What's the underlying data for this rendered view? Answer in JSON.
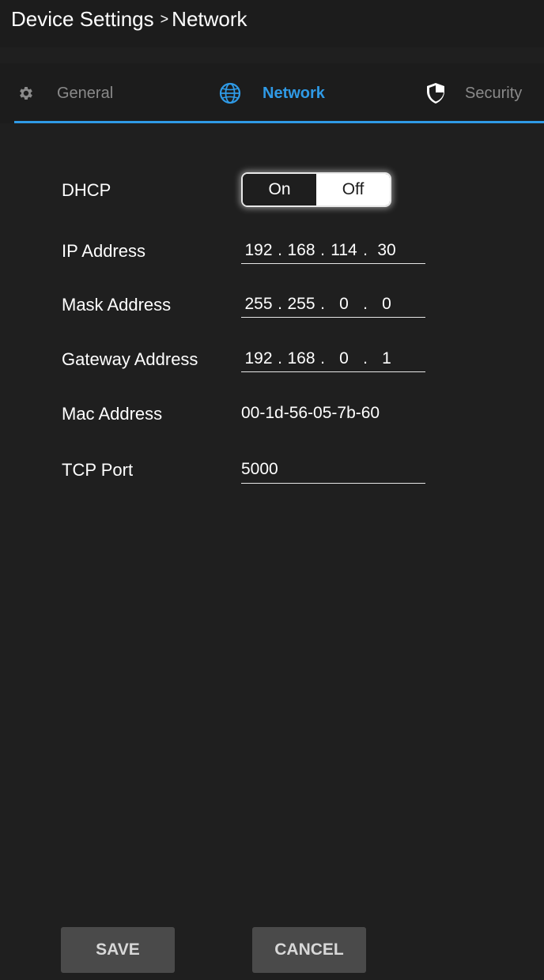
{
  "header": {
    "breadcrumb": {
      "parent": "Device Settings",
      "separator": ">",
      "current": "Network"
    }
  },
  "tabs": [
    {
      "label": "General",
      "icon": "gear-icon",
      "active": false
    },
    {
      "label": "Network",
      "icon": "globe-icon",
      "active": true
    },
    {
      "label": "Security",
      "icon": "shield-icon",
      "active": false
    }
  ],
  "form": {
    "dhcp": {
      "label": "DHCP",
      "on_label": "On",
      "off_label": "Off",
      "selected": "Off"
    },
    "ip_address": {
      "label": "IP Address",
      "octets": [
        "192",
        "168",
        "114",
        "30"
      ]
    },
    "mask_address": {
      "label": "Mask Address",
      "octets": [
        "255",
        "255",
        "0",
        "0"
      ]
    },
    "gateway_address": {
      "label": "Gateway Address",
      "octets": [
        "192",
        "168",
        "0",
        "1"
      ]
    },
    "mac_address": {
      "label": "Mac Address",
      "value": "00-1d-56-05-7b-60"
    },
    "tcp_port": {
      "label": "TCP Port",
      "value": "5000"
    }
  },
  "actions": {
    "save_label": "SAVE",
    "cancel_label": "CANCEL"
  },
  "colors": {
    "background": "#1f1f1f",
    "accent": "#2f9ae6",
    "inactive_tab": "#8a8a8a",
    "button_bg": "#4a4a4a"
  }
}
